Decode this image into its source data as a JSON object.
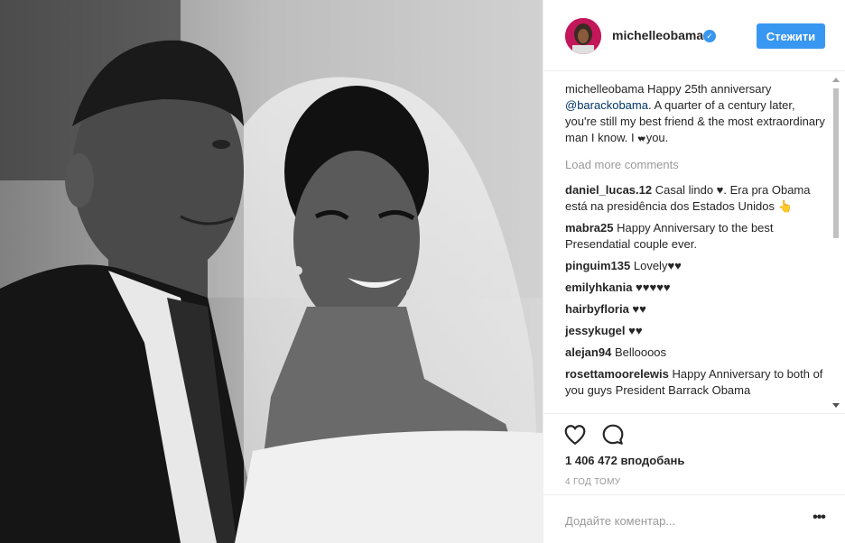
{
  "post": {
    "username": "michelleobama",
    "verified_icon": "check-icon",
    "follow_label": "Стежити",
    "caption": {
      "user": "michelleobama",
      "text_1": " Happy 25th anniversary ",
      "mention": "@barackobama",
      "text_2": ". A quarter of a century later, you're still my best friend & the most extraordinary man I know. I ",
      "emoji": "♥♥",
      "text_3": " you."
    },
    "load_more": "Load more comments",
    "comments": [
      {
        "user": "daniel_lucas.12",
        "text": " Casal lindo ♥. Era pra Obama está na presidência dos Estados Unidos 👆"
      },
      {
        "user": "mabra25",
        "text": " Happy Anniversary to the best Presendatial couple ever."
      },
      {
        "user": "pinguim135",
        "text": " Lovely♥♥"
      },
      {
        "user": "emilyhkania",
        "text": " ♥♥♥♥♥"
      },
      {
        "user": "hairbyfloria",
        "text": " ♥♥"
      },
      {
        "user": "jessykugel",
        "text": " ♥♥"
      },
      {
        "user": "alejan94",
        "text": " Belloooos"
      },
      {
        "user": "rosettamoorelewis",
        "text": " Happy Anniversary to both of you guys President Barrack Obama"
      }
    ],
    "likes": "1 406 472 вподобань",
    "time_ago": "4 ГОД ТОМУ",
    "comment_placeholder": "Додайте коментар...",
    "more_label": "•••",
    "icons": {
      "like": "heart-icon",
      "comment": "comment-bubble-icon",
      "more": "ellipsis-icon"
    },
    "colors": {
      "accent": "#3897f0",
      "mention": "#003569",
      "muted": "#999999"
    }
  }
}
